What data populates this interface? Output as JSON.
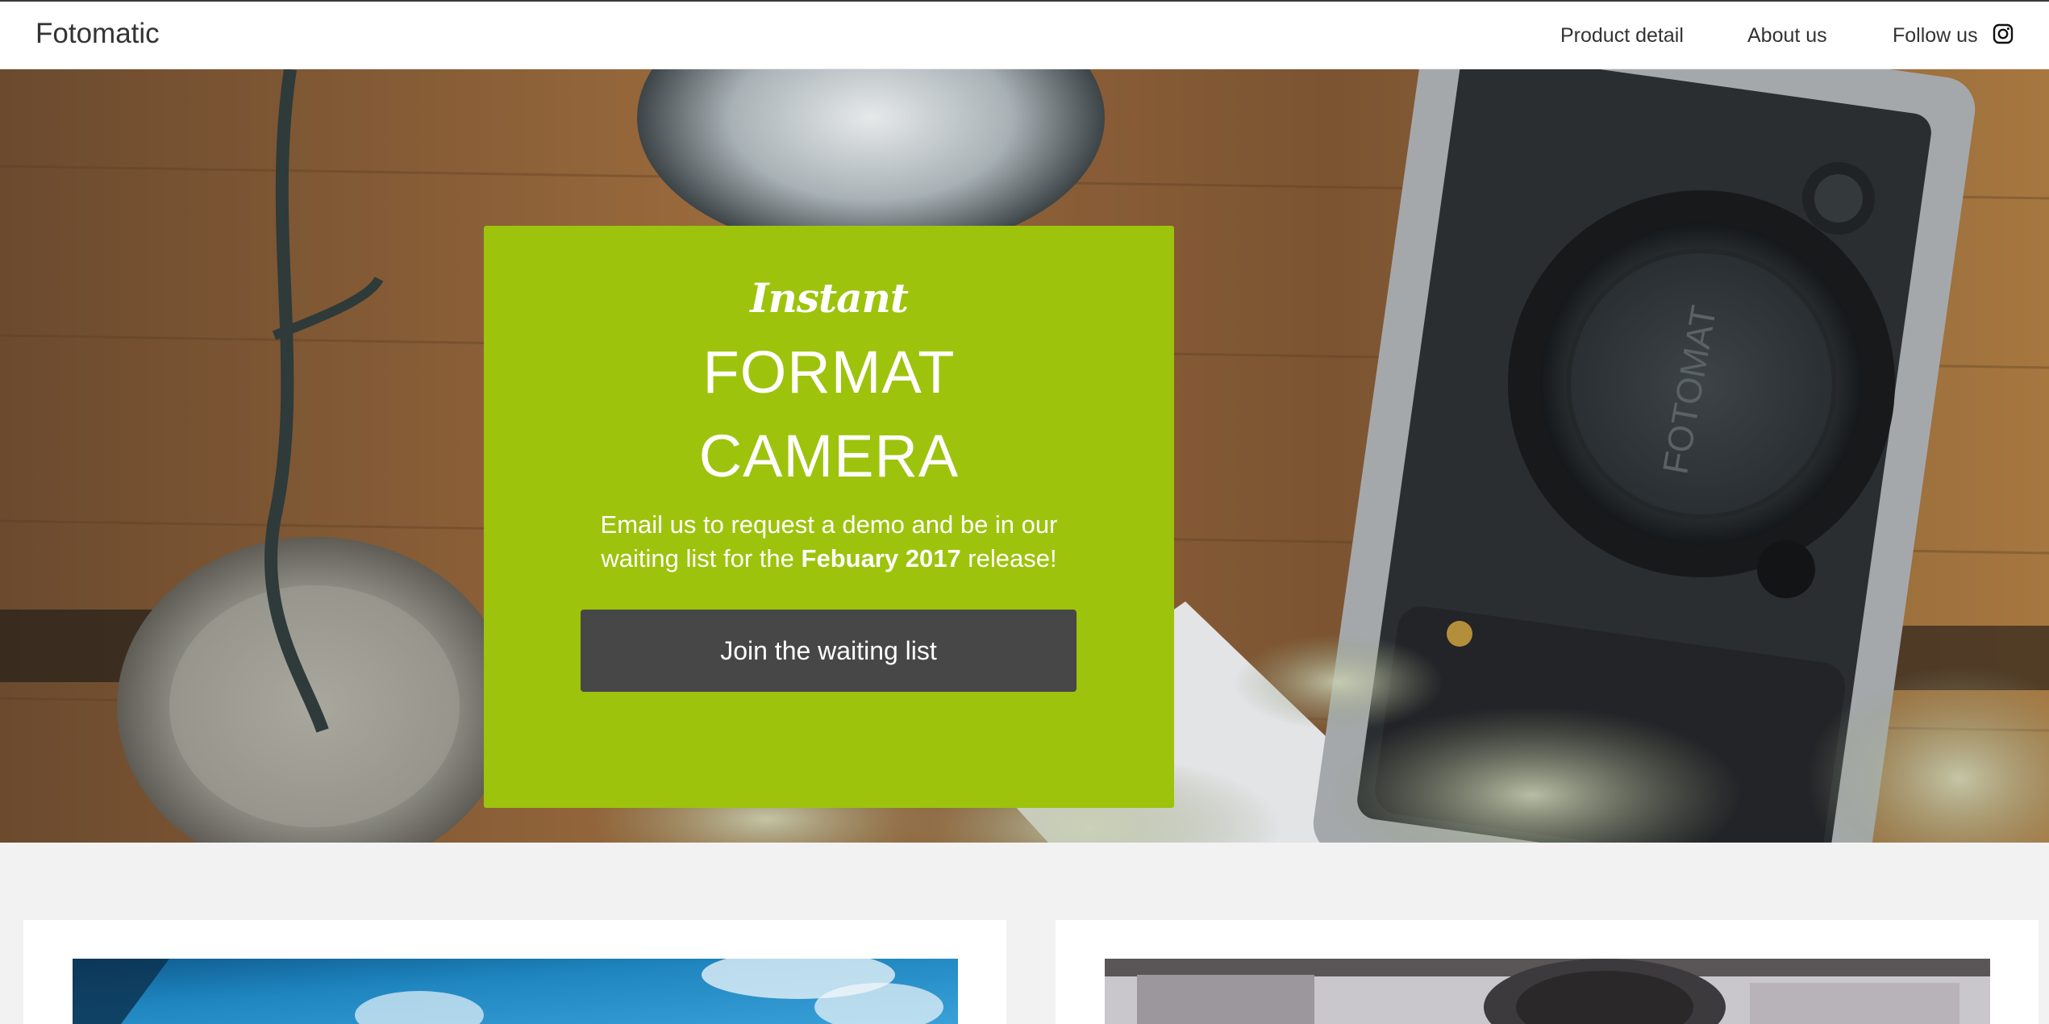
{
  "header": {
    "brand": "Fotomatic",
    "nav": [
      {
        "label": "Product detail"
      },
      {
        "label": "About us"
      },
      {
        "label": "Follow us"
      }
    ],
    "social_icon": "instagram-icon"
  },
  "hero": {
    "eyebrow": "Instant",
    "title_line1": "FORMAT",
    "title_line2": "CAMERA",
    "text_before": "Email us to request a demo and be in our waiting list for the ",
    "text_bold": "Febuary 2017",
    "text_after": " release!",
    "cta_label": "Join the waiting list",
    "lens_cap_text": "FOTOMAT",
    "colors": {
      "promo_bg": "#9dc30c",
      "cta_bg": "#474747"
    }
  },
  "cards": [
    {
      "image": "sky-photo"
    },
    {
      "image": "camera-closeup-photo"
    }
  ]
}
